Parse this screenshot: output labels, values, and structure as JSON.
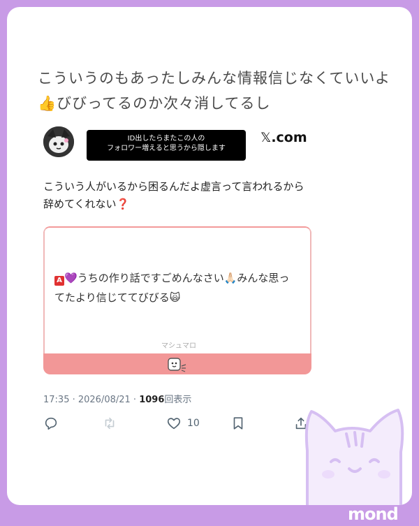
{
  "headline": "こういうのもあったしみんな情報信じなくていいよ👍びびってるのか次々消してるし",
  "redaction": {
    "line1": "ID出したらまたこの人の",
    "line2": "フォロワー増えると思うから隠します"
  },
  "source": {
    "logo": "𝕏",
    "domain": ".com"
  },
  "tweet": {
    "text": "こういう人がいるから困るんだよ虚言って言われるから辞めてくれない❓",
    "card": {
      "badge": "A",
      "heart": "💜",
      "text": "うちの作り話ですごめんなさい🙏🏻みんな思ってたより信じててびびる🙀",
      "footer": "マシュマロ"
    },
    "time": "17:35 · 2026/08/21 · ",
    "views_count": "1096",
    "views_label": "回表示",
    "likes": "10"
  },
  "watermark": "mond",
  "icons": [
    "reply-icon",
    "retweet-icon",
    "like-icon",
    "bookmark-icon",
    "share-icon",
    "cat-doodle-icon",
    "avatar-image"
  ],
  "colors": {
    "frame": "#c89be6",
    "card_band": "#f29797",
    "x_blue": "#536471"
  }
}
